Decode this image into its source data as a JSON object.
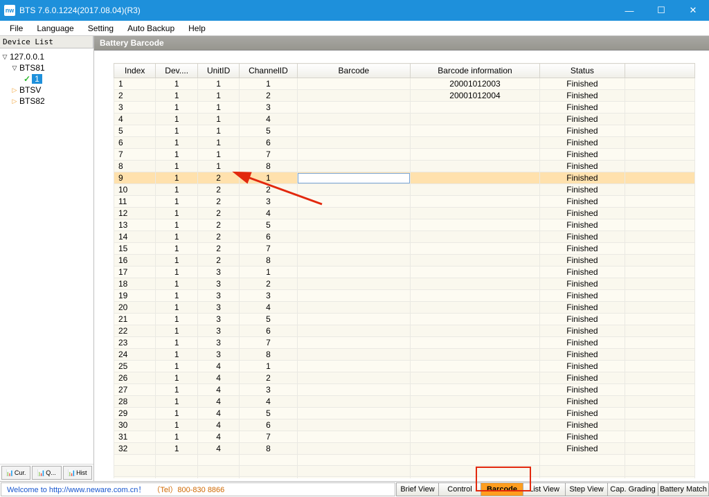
{
  "window": {
    "title": "BTS 7.6.0.1224(2017.08.04)(R3)",
    "app_abbr": "nw"
  },
  "menu": [
    "File",
    "Language",
    "Setting",
    "Auto Backup",
    "Help"
  ],
  "sidebar": {
    "header": "Device List",
    "root": "127.0.0.1",
    "nodes": [
      {
        "label": "BTS81",
        "expanded": true,
        "children": [
          {
            "label": "1",
            "selected": true
          }
        ]
      },
      {
        "label": "BTSV",
        "expanded": false
      },
      {
        "label": "BTS82",
        "expanded": false
      }
    ],
    "bottom": [
      "Cur.",
      "Q...",
      "Hist"
    ]
  },
  "panel": {
    "title": "Battery Barcode"
  },
  "table": {
    "headers": [
      "Index",
      "Dev....",
      "UnitID",
      "ChannelID",
      "Barcode",
      "Barcode information",
      "Status",
      ""
    ],
    "rows": [
      {
        "index": 1,
        "dev": 1,
        "unit": 1,
        "chan": 1,
        "barcode": "",
        "binf": "20001012003",
        "status": "Finished"
      },
      {
        "index": 2,
        "dev": 1,
        "unit": 1,
        "chan": 2,
        "barcode": "",
        "binf": "20001012004",
        "status": "Finished"
      },
      {
        "index": 3,
        "dev": 1,
        "unit": 1,
        "chan": 3,
        "barcode": "",
        "binf": "",
        "status": "Finished"
      },
      {
        "index": 4,
        "dev": 1,
        "unit": 1,
        "chan": 4,
        "barcode": "",
        "binf": "",
        "status": "Finished"
      },
      {
        "index": 5,
        "dev": 1,
        "unit": 1,
        "chan": 5,
        "barcode": "",
        "binf": "",
        "status": "Finished"
      },
      {
        "index": 6,
        "dev": 1,
        "unit": 1,
        "chan": 6,
        "barcode": "",
        "binf": "",
        "status": "Finished"
      },
      {
        "index": 7,
        "dev": 1,
        "unit": 1,
        "chan": 7,
        "barcode": "",
        "binf": "",
        "status": "Finished"
      },
      {
        "index": 8,
        "dev": 1,
        "unit": 1,
        "chan": 8,
        "barcode": "",
        "binf": "",
        "status": "Finished"
      },
      {
        "index": 9,
        "dev": 1,
        "unit": 2,
        "chan": 1,
        "barcode": "",
        "binf": "",
        "status": "Finished",
        "editing": true
      },
      {
        "index": 10,
        "dev": 1,
        "unit": 2,
        "chan": 2,
        "barcode": "",
        "binf": "",
        "status": "Finished"
      },
      {
        "index": 11,
        "dev": 1,
        "unit": 2,
        "chan": 3,
        "barcode": "",
        "binf": "",
        "status": "Finished"
      },
      {
        "index": 12,
        "dev": 1,
        "unit": 2,
        "chan": 4,
        "barcode": "",
        "binf": "",
        "status": "Finished"
      },
      {
        "index": 13,
        "dev": 1,
        "unit": 2,
        "chan": 5,
        "barcode": "",
        "binf": "",
        "status": "Finished"
      },
      {
        "index": 14,
        "dev": 1,
        "unit": 2,
        "chan": 6,
        "barcode": "",
        "binf": "",
        "status": "Finished"
      },
      {
        "index": 15,
        "dev": 1,
        "unit": 2,
        "chan": 7,
        "barcode": "",
        "binf": "",
        "status": "Finished"
      },
      {
        "index": 16,
        "dev": 1,
        "unit": 2,
        "chan": 8,
        "barcode": "",
        "binf": "",
        "status": "Finished"
      },
      {
        "index": 17,
        "dev": 1,
        "unit": 3,
        "chan": 1,
        "barcode": "",
        "binf": "",
        "status": "Finished"
      },
      {
        "index": 18,
        "dev": 1,
        "unit": 3,
        "chan": 2,
        "barcode": "",
        "binf": "",
        "status": "Finished"
      },
      {
        "index": 19,
        "dev": 1,
        "unit": 3,
        "chan": 3,
        "barcode": "",
        "binf": "",
        "status": "Finished"
      },
      {
        "index": 20,
        "dev": 1,
        "unit": 3,
        "chan": 4,
        "barcode": "",
        "binf": "",
        "status": "Finished"
      },
      {
        "index": 21,
        "dev": 1,
        "unit": 3,
        "chan": 5,
        "barcode": "",
        "binf": "",
        "status": "Finished"
      },
      {
        "index": 22,
        "dev": 1,
        "unit": 3,
        "chan": 6,
        "barcode": "",
        "binf": "",
        "status": "Finished"
      },
      {
        "index": 23,
        "dev": 1,
        "unit": 3,
        "chan": 7,
        "barcode": "",
        "binf": "",
        "status": "Finished"
      },
      {
        "index": 24,
        "dev": 1,
        "unit": 3,
        "chan": 8,
        "barcode": "",
        "binf": "",
        "status": "Finished"
      },
      {
        "index": 25,
        "dev": 1,
        "unit": 4,
        "chan": 1,
        "barcode": "",
        "binf": "",
        "status": "Finished"
      },
      {
        "index": 26,
        "dev": 1,
        "unit": 4,
        "chan": 2,
        "barcode": "",
        "binf": "",
        "status": "Finished"
      },
      {
        "index": 27,
        "dev": 1,
        "unit": 4,
        "chan": 3,
        "barcode": "",
        "binf": "",
        "status": "Finished"
      },
      {
        "index": 28,
        "dev": 1,
        "unit": 4,
        "chan": 4,
        "barcode": "",
        "binf": "",
        "status": "Finished"
      },
      {
        "index": 29,
        "dev": 1,
        "unit": 4,
        "chan": 5,
        "barcode": "",
        "binf": "",
        "status": "Finished"
      },
      {
        "index": 30,
        "dev": 1,
        "unit": 4,
        "chan": 6,
        "barcode": "",
        "binf": "",
        "status": "Finished"
      },
      {
        "index": 31,
        "dev": 1,
        "unit": 4,
        "chan": 7,
        "barcode": "",
        "binf": "",
        "status": "Finished"
      },
      {
        "index": 32,
        "dev": 1,
        "unit": 4,
        "chan": 8,
        "barcode": "",
        "binf": "",
        "status": "Finished"
      }
    ],
    "empty_rows": 3
  },
  "status": {
    "welcome": "Welcome to http://www.neware.com.cn！",
    "tel": "（Tel）800-830 8866"
  },
  "tabs": [
    "Brief View",
    "Control",
    "Barcode",
    "List View",
    "Step View",
    "Cap. Grading",
    "Battery Match"
  ],
  "active_tab": "Barcode"
}
